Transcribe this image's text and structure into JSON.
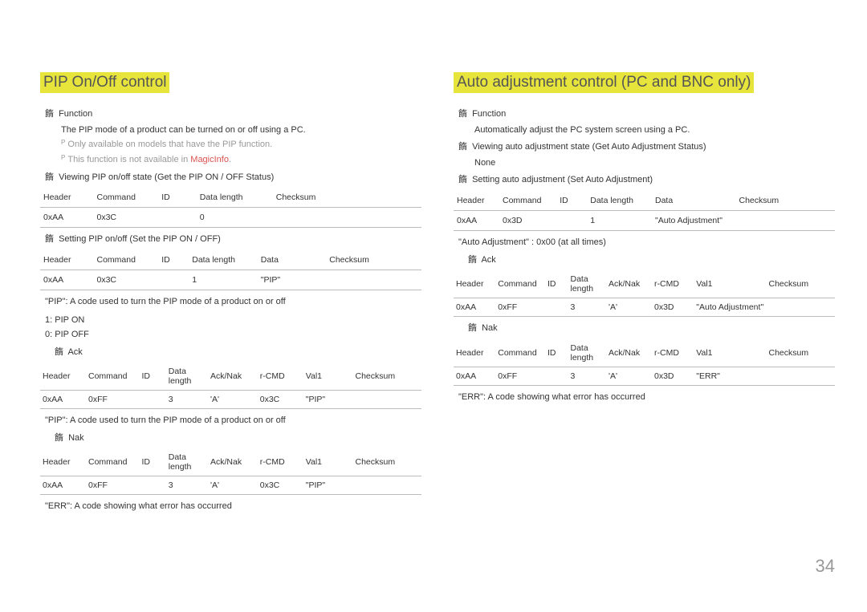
{
  "pageNumber": "34",
  "left": {
    "title": "PIP On/Off control",
    "functionLabel": "Function",
    "functionDesc": "The PIP mode of a product can be turned on or off using a PC.",
    "note1_pre": "Only available on models that have the PIP function.",
    "note2_pre": "This function is not available in ",
    "note2_red": "MagicInfo",
    "note2_post": ".",
    "viewLabel": "Viewing PIP on/off state (Get the PIP ON / OFF Status)",
    "tableHeaders5": [
      "Header",
      "Command",
      "ID",
      "Data length",
      "Checksum"
    ],
    "viewRow": [
      "0xAA",
      "0x3C",
      "",
      "0",
      ""
    ],
    "setLabel": "Setting PIP on/off (Set the PIP ON / OFF)",
    "tableHeaders6": [
      "Header",
      "Command",
      "ID",
      "Data length",
      "Data",
      "Checksum"
    ],
    "setRow": [
      "0xAA",
      "0x3C",
      "",
      "1",
      "\"PIP\"",
      ""
    ],
    "pipDesc": "\"PIP\": A code used to turn the PIP mode of a product on or off",
    "pipOn": "1: PIP ON",
    "pipOff": "0: PIP OFF",
    "ackLabel": "Ack",
    "tableHeaders8": [
      "Header",
      "Command",
      "ID",
      "Data length",
      "Ack/Nak",
      "r-CMD",
      "Val1",
      "Checksum"
    ],
    "ackRow": [
      "0xAA",
      "0xFF",
      "",
      "3",
      "'A'",
      "0x3C",
      "\"PIP\"",
      ""
    ],
    "ackDesc": "\"PIP\": A code used to turn the PIP mode of a product on or off",
    "nakLabel": "Nak",
    "nakRow": [
      "0xAA",
      "0xFF",
      "",
      "3",
      "'A'",
      "0x3C",
      "\"PIP\"",
      ""
    ],
    "errDesc": "\"ERR\": A code showing what error has occurred"
  },
  "right": {
    "title": "Auto adjustment control (PC and BNC only)",
    "functionLabel": "Function",
    "functionDesc": "Automatically adjust the PC system screen using a PC.",
    "viewLabel": "Viewing auto adjustment state (Get Auto Adjustment Status)",
    "none": "None",
    "setLabel": "Setting auto adjustment (Set Auto Adjustment)",
    "tableHeaders6": [
      "Header",
      "Command",
      "ID",
      "Data length",
      "Data",
      "Checksum"
    ],
    "setRow": [
      "0xAA",
      "0x3D",
      "",
      "1",
      "\"Auto Adjustment\"",
      ""
    ],
    "autoAdjNote": "\"Auto Adjustment\" : 0x00 (at all times)",
    "ackLabel": "Ack",
    "tableHeaders8": [
      "Header",
      "Command",
      "ID",
      "Data length",
      "Ack/Nak",
      "r-CMD",
      "Val1",
      "Checksum"
    ],
    "ackRow": [
      "0xAA",
      "0xFF",
      "",
      "3",
      "'A'",
      "0x3D",
      "\"Auto Adjustment\"",
      ""
    ],
    "nakLabel": "Nak",
    "nakRow": [
      "0xAA",
      "0xFF",
      "",
      "3",
      "'A'",
      "0x3D",
      "\"ERR\"",
      ""
    ],
    "errDesc": "\"ERR\": A code showing what error has occurred"
  }
}
